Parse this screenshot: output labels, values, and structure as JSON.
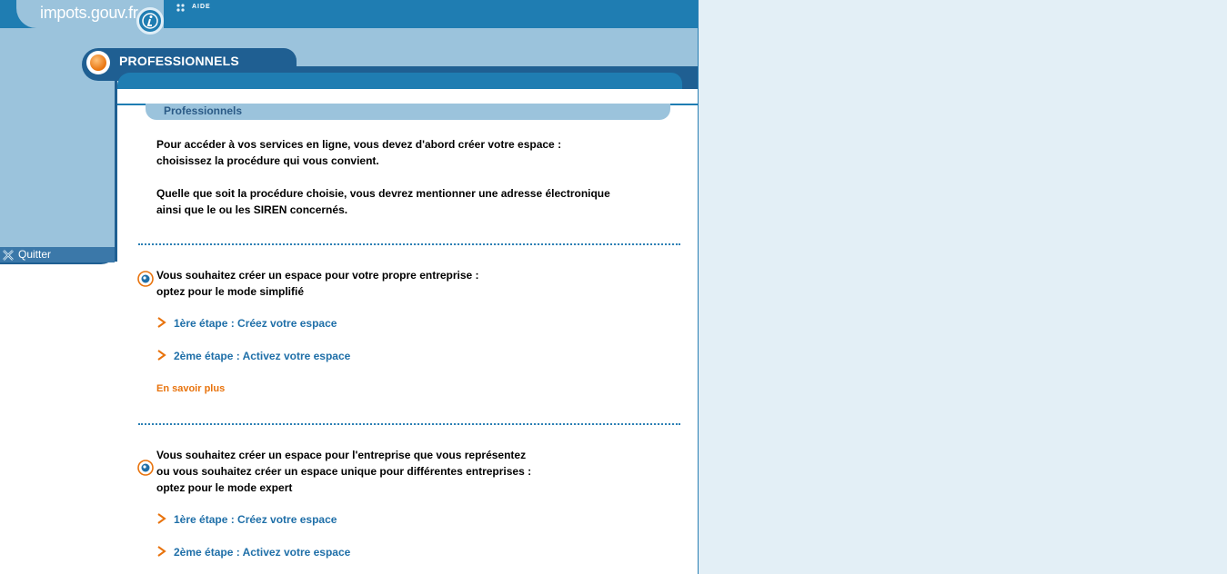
{
  "header": {
    "site_name": "impots.gouv.fr",
    "help_label": "AIDE"
  },
  "sidebar": {
    "quit_label": "Quitter"
  },
  "banner": {
    "title": "PROFESSIONNELS"
  },
  "section": {
    "title": "Professionnels"
  },
  "intro": {
    "line1": "Pour accéder à vos services en ligne, vous devez d'abord créer votre espace :",
    "line2": "choisissez la procédure qui vous convient.",
    "line3": "Quelle que soit la procédure choisie, vous devrez mentionner une adresse électronique",
    "line4": "ainsi que le ou les SIREN concernés."
  },
  "simplified": {
    "line1": "Vous souhaitez créer un espace pour votre propre entreprise :",
    "line2": "optez pour le mode simplifié",
    "step1": "1ère étape : Créez votre espace",
    "step2": "2ème étape : Activez votre espace",
    "more": "En savoir plus"
  },
  "expert": {
    "line1": "Vous souhaitez créer un espace pour l'entreprise que vous représentez",
    "line2": "ou vous souhaitez créer un espace unique pour différentes entreprises :",
    "line3": "optez pour le mode expert",
    "step1": "1ère étape : Créez votre espace",
    "step2": "2ème étape : Activez votre espace"
  },
  "colors": {
    "primary_blue": "#1f7db2",
    "light_blue": "#9bc3dc",
    "dark_blue": "#1f5f92",
    "accent_orange": "#e8730d",
    "page_background": "#e3eff6"
  }
}
